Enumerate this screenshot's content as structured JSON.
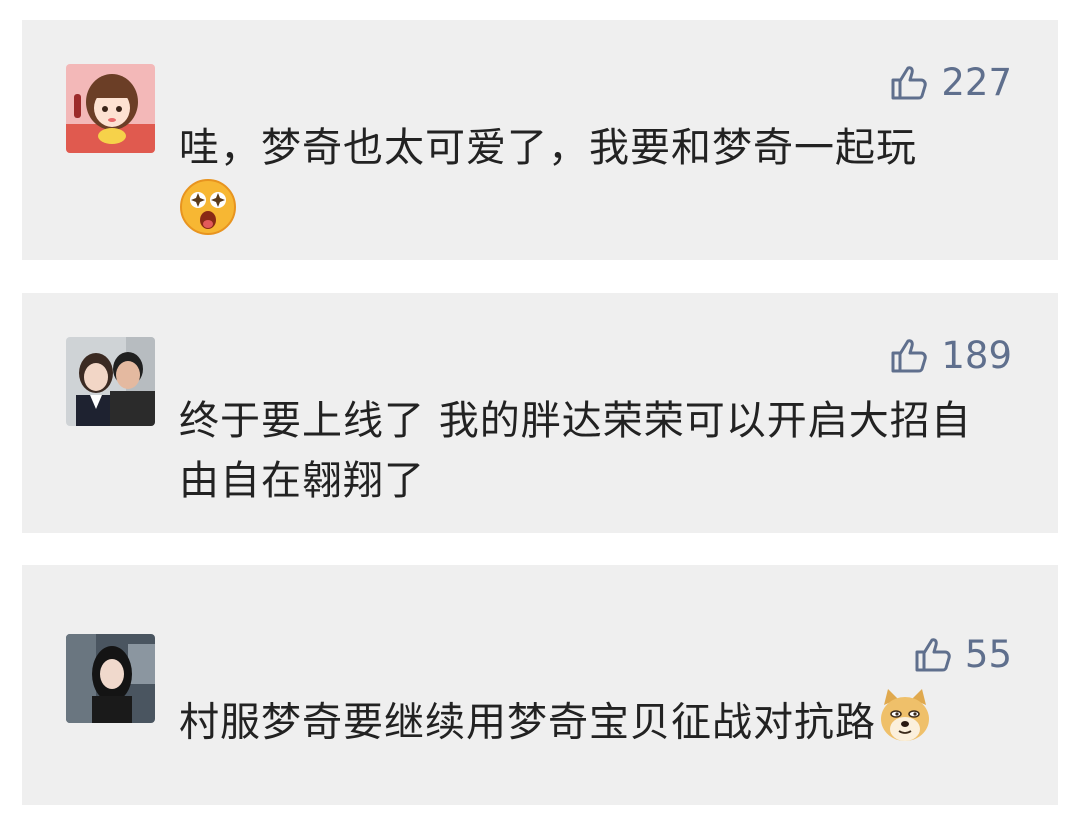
{
  "comments": [
    {
      "likes": "227",
      "text": "哇，梦奇也太可爱了，我要和梦奇一起玩",
      "emoji": "star-eyes-emoji"
    },
    {
      "likes": "189",
      "text": "终于要上线了 我的胖达荣荣可以开启大招自由自在翱翔了"
    },
    {
      "likes": "55",
      "text": "村服梦奇要继续用梦奇宝贝征战对抗路",
      "emoji": "doge-emoji"
    }
  ],
  "colors": {
    "card_bg": "#efefef",
    "like_color": "#5f6f8d",
    "text_color": "#222222"
  }
}
